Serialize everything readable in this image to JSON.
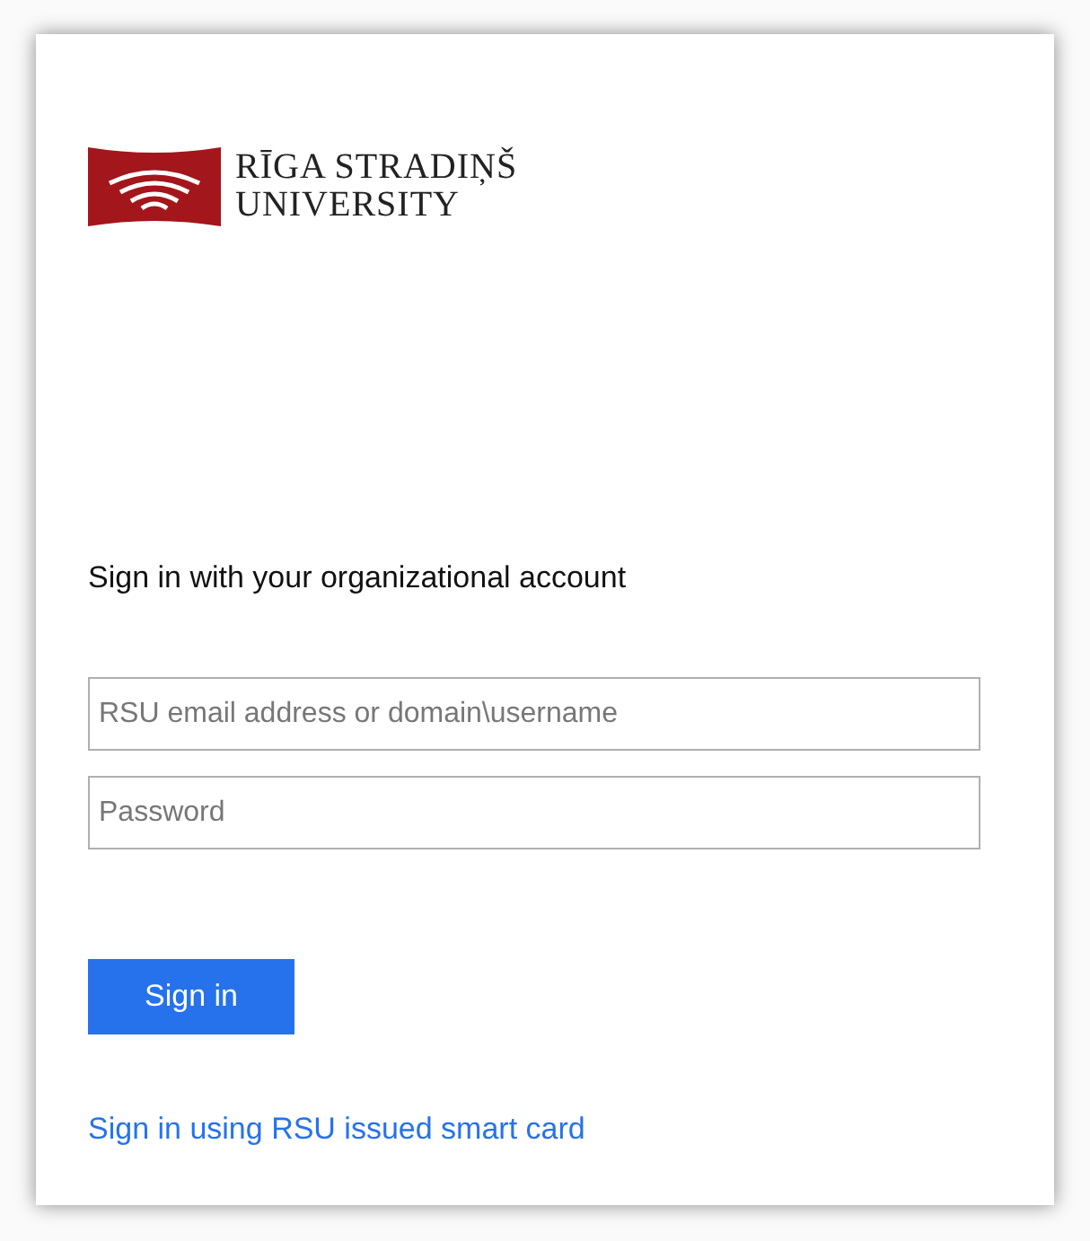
{
  "logo": {
    "line_1": "RĪGA STRADIŅŠ",
    "line_2": "UNIVERSITY"
  },
  "heading": "Sign in with your organizational account",
  "fields": [
    {
      "placeholder": "RSU email address or domain\\username"
    },
    {
      "placeholder": "Password"
    }
  ],
  "sign_in_button": "Sign in",
  "smart_card_link": "Sign in using RSU issued smart card"
}
